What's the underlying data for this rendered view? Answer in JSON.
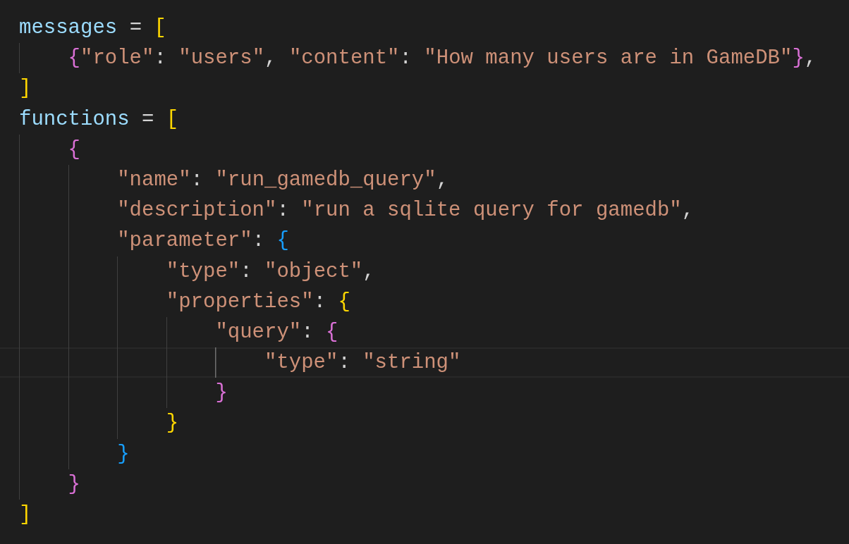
{
  "editor": {
    "lines": [
      {
        "current": false,
        "tokens": [
          {
            "kind": "variable",
            "text": "messages"
          },
          {
            "kind": "operator",
            "text": " = "
          },
          {
            "kind": "open",
            "text": "["
          }
        ]
      },
      {
        "current": false,
        "tokens": [
          {
            "kind": "open",
            "text": "{"
          },
          {
            "kind": "string",
            "text": "\"role\""
          },
          {
            "kind": "punctuation",
            "text": ": "
          },
          {
            "kind": "string",
            "text": "\"users\""
          },
          {
            "kind": "punctuation",
            "text": ", "
          },
          {
            "kind": "string",
            "text": "\"content\""
          },
          {
            "kind": "punctuation",
            "text": ": "
          },
          {
            "kind": "string",
            "text": "\"How many users are in GameDB\""
          },
          {
            "kind": "close",
            "text": "}"
          },
          {
            "kind": "punctuation",
            "text": ","
          }
        ]
      },
      {
        "current": false,
        "tokens": [
          {
            "kind": "close",
            "text": "]"
          }
        ]
      },
      {
        "current": false,
        "tokens": [
          {
            "kind": "variable",
            "text": "functions"
          },
          {
            "kind": "operator",
            "text": " = "
          },
          {
            "kind": "open",
            "text": "["
          }
        ]
      },
      {
        "current": false,
        "tokens": [
          {
            "kind": "open",
            "text": "{"
          }
        ]
      },
      {
        "current": false,
        "tokens": [
          {
            "kind": "string",
            "text": "\"name\""
          },
          {
            "kind": "punctuation",
            "text": ": "
          },
          {
            "kind": "string",
            "text": "\"run_gamedb_query\""
          },
          {
            "kind": "punctuation",
            "text": ","
          }
        ]
      },
      {
        "current": false,
        "tokens": [
          {
            "kind": "string",
            "text": "\"description\""
          },
          {
            "kind": "punctuation",
            "text": ": "
          },
          {
            "kind": "string",
            "text": "\"run a sqlite query for gamedb\""
          },
          {
            "kind": "punctuation",
            "text": ","
          }
        ]
      },
      {
        "current": false,
        "tokens": [
          {
            "kind": "string",
            "text": "\"parameter\""
          },
          {
            "kind": "punctuation",
            "text": ": "
          },
          {
            "kind": "open",
            "text": "{"
          }
        ]
      },
      {
        "current": false,
        "tokens": [
          {
            "kind": "string",
            "text": "\"type\""
          },
          {
            "kind": "punctuation",
            "text": ": "
          },
          {
            "kind": "string",
            "text": "\"object\""
          },
          {
            "kind": "punctuation",
            "text": ","
          }
        ]
      },
      {
        "current": false,
        "tokens": [
          {
            "kind": "string",
            "text": "\"properties\""
          },
          {
            "kind": "punctuation",
            "text": ": "
          },
          {
            "kind": "open",
            "text": "{"
          }
        ]
      },
      {
        "current": false,
        "tokens": [
          {
            "kind": "string",
            "text": "\"query\""
          },
          {
            "kind": "punctuation",
            "text": ": "
          },
          {
            "kind": "open",
            "text": "{"
          }
        ]
      },
      {
        "current": true,
        "tokens": [
          {
            "kind": "string",
            "text": "\"type\""
          },
          {
            "kind": "punctuation",
            "text": ": "
          },
          {
            "kind": "string",
            "text": "\"string\""
          }
        ]
      },
      {
        "current": false,
        "tokens": [
          {
            "kind": "close",
            "text": "}"
          }
        ]
      },
      {
        "current": false,
        "tokens": [
          {
            "kind": "close",
            "text": "}"
          }
        ]
      },
      {
        "current": false,
        "tokens": [
          {
            "kind": "close",
            "text": "}"
          }
        ]
      },
      {
        "current": false,
        "tokens": [
          {
            "kind": "close",
            "text": "}"
          }
        ]
      },
      {
        "current": false,
        "tokens": [
          {
            "kind": "close",
            "text": "]"
          }
        ]
      }
    ]
  }
}
